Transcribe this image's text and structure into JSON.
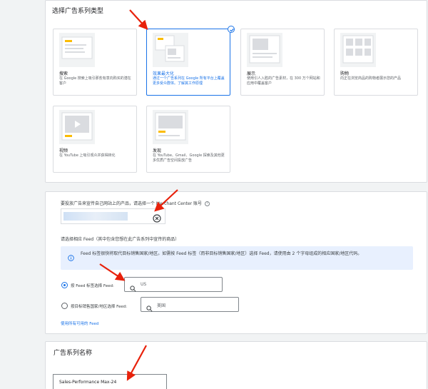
{
  "campaign_type_section": {
    "title": "选择广告系列类型",
    "tiles": [
      {
        "title": "搜索",
        "desc": "在 Google 搜索上吸引那些有意向购买的潜在客户",
        "selected": false
      },
      {
        "title": "效果最大化",
        "desc": "通过一个广告系列在 Google 所有平台上覆盖更多受众群体。了解其工作原理",
        "selected": true
      },
      {
        "title": "展示",
        "desc": "使用引人入胜的广告素材，在 300 万个网站和应用中覆盖客户",
        "selected": false
      },
      {
        "title": "购物",
        "desc": "向正在浏览商品的购物者展示您的产品",
        "selected": false
      },
      {
        "title": "视频",
        "desc": "在 YouTube 上吸引观众并获得转化",
        "selected": false
      },
      {
        "title": "发现",
        "desc": "在 YouTube、Gmail、Google 探索及其他更多优质广告空间投放广告",
        "selected": false
      }
    ]
  },
  "merchant_section": {
    "label": "要投放广告来宣传自己网站上的产品，请选择一个 Merchant Center 账号",
    "feed_label": "请选择相应 Feed（其中包含您想在此广告系列中宣传的商品）",
    "info_text": "Feed 标签很快将取代目标销售国家/地区。如需按 Feed 标签（而非目标销售国家/地区）选择 Feed，请使用由 2 个字母组成的相应国家/地区代码。",
    "radio_feed_label": "按 Feed 标签选择 Feed:",
    "radio_feed_value": "US",
    "radio_country_label": "按目标销售国家/地区选择 Feed:",
    "radio_country_value": "美国",
    "all_feeds_link": "使用所有可用的 Feed"
  },
  "campaign_name_section": {
    "title": "广告系列名称",
    "value": "Sales-Performance Max-24"
  },
  "colors": {
    "accent": "#1a73e8",
    "annotation": "#e8210b",
    "info_bg": "#e8f0fe"
  }
}
